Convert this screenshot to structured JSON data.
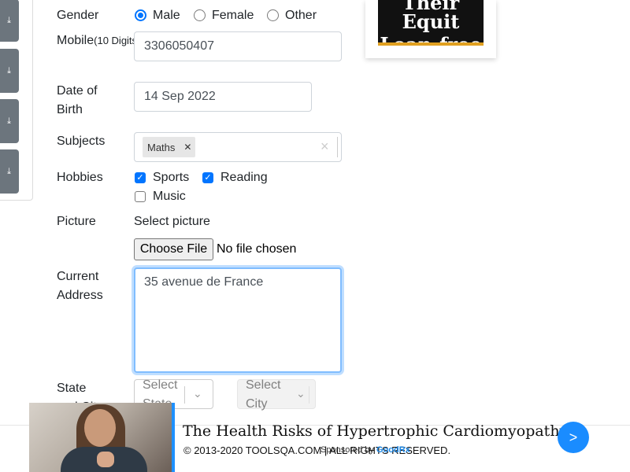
{
  "sidebar": {
    "download_icons": [
      "download-icon",
      "download-icon",
      "download-icon",
      "download-icon"
    ]
  },
  "form": {
    "gender": {
      "label": "Gender",
      "options": [
        "Male",
        "Female",
        "Other"
      ],
      "selected": "Male"
    },
    "mobile": {
      "label": "Mobile",
      "hint": "(10 Digits)",
      "value": "3306050407"
    },
    "dob": {
      "label_line1": "Date of",
      "label_line2": "Birth",
      "value": "14 Sep 2022"
    },
    "subjects": {
      "label": "Subjects",
      "chips": [
        "Maths"
      ],
      "clear_icon": "×"
    },
    "hobbies": {
      "label": "Hobbies",
      "items": [
        {
          "name": "Sports",
          "checked": true
        },
        {
          "name": "Reading",
          "checked": true
        },
        {
          "name": "Music",
          "checked": false
        }
      ]
    },
    "picture": {
      "label": "Picture",
      "select_label": "Select picture",
      "button": "Choose File",
      "status": "No file chosen"
    },
    "address": {
      "label_line1": "Current",
      "label_line2": "Address",
      "value": "35 avenue de France"
    },
    "state_city": {
      "label_line1": "State",
      "label_line2": "and City",
      "state_placeholder_line1": "Select",
      "state_placeholder_line2": "State",
      "city_placeholder_line1": "Select",
      "city_placeholder_line2": "City"
    }
  },
  "ad": {
    "line1": "Their Equit",
    "line2": "Loan-free"
  },
  "footer": {
    "copyright": "© 2013-2020 TOOLSQA.COM | ALL RIGHTS RESERVED.",
    "banner_title": "The Health Risks of Hypertrophic Cardiomyopathy",
    "sponsored_prefix": "Sponsored by",
    "sponsor_name": "GoodRx",
    "next_label": ">"
  },
  "colors": {
    "accent": "#0075ff",
    "focus_border": "#80bdff",
    "sidebar_btn": "#6c757d",
    "next_button": "#1a8cff"
  }
}
